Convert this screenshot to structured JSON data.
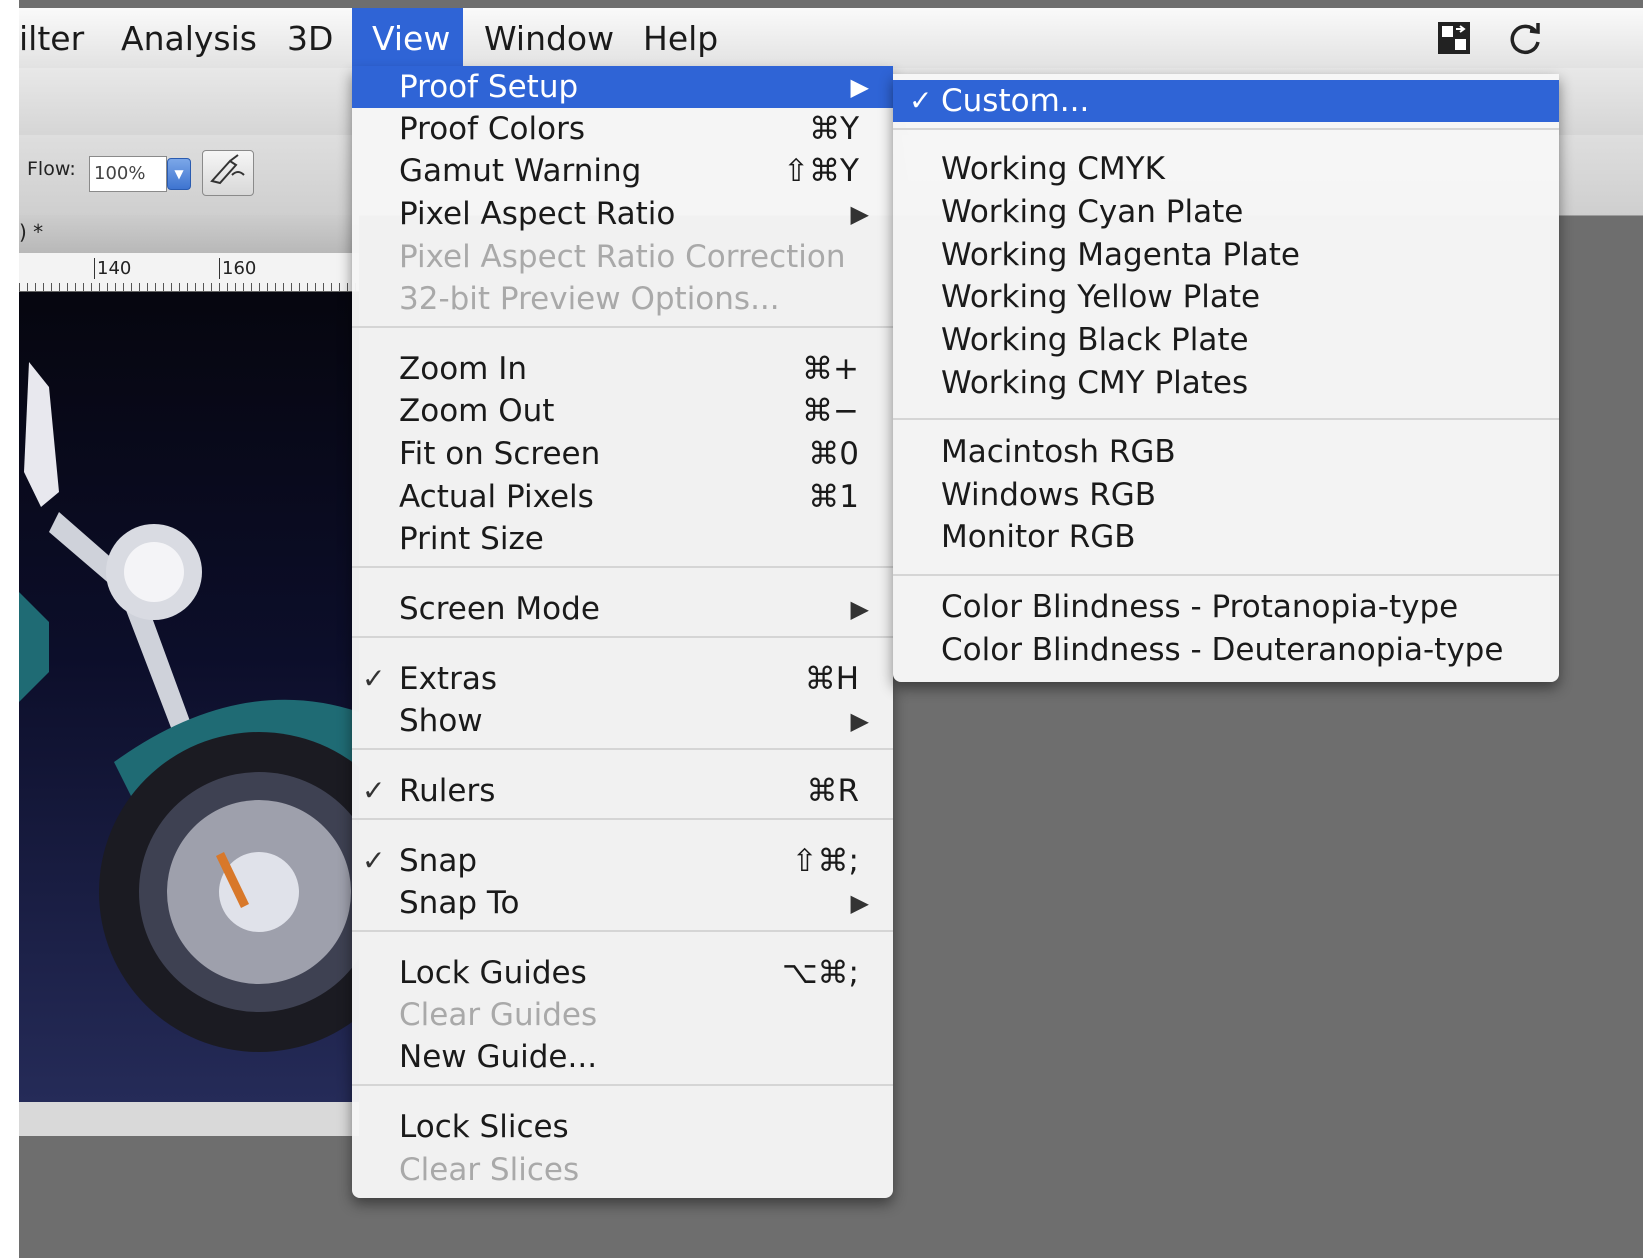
{
  "menubar": {
    "items": [
      {
        "label": "ilter"
      },
      {
        "label": "Analysis"
      },
      {
        "label": "3D"
      },
      {
        "label": "View"
      },
      {
        "label": "Window"
      },
      {
        "label": "Help"
      }
    ]
  },
  "options": {
    "flow_label": "Flow:",
    "flow_value": "100%"
  },
  "document": {
    "tab_title": ") *",
    "ruler_labels": [
      "140",
      "160"
    ]
  },
  "view_menu": {
    "items": [
      {
        "label": "Proof Setup",
        "shortcut": "",
        "submenu": true,
        "check": "",
        "state": "highlight"
      },
      {
        "label": "Proof Colors",
        "shortcut": "⌘Y",
        "submenu": false,
        "check": "",
        "state": "normal"
      },
      {
        "label": "Gamut Warning",
        "shortcut": "⇧⌘Y",
        "submenu": false,
        "check": "",
        "state": "normal"
      },
      {
        "label": "Pixel Aspect Ratio",
        "shortcut": "",
        "submenu": true,
        "check": "",
        "state": "normal"
      },
      {
        "label": "Pixel Aspect Ratio Correction",
        "shortcut": "",
        "submenu": false,
        "check": "",
        "state": "disabled"
      },
      {
        "label": "32-bit Preview Options...",
        "shortcut": "",
        "submenu": false,
        "check": "",
        "state": "disabled"
      },
      {
        "label": "Zoom In",
        "shortcut": "⌘+",
        "submenu": false,
        "check": "",
        "state": "normal"
      },
      {
        "label": "Zoom Out",
        "shortcut": "⌘−",
        "submenu": false,
        "check": "",
        "state": "normal"
      },
      {
        "label": "Fit on Screen",
        "shortcut": "⌘0",
        "submenu": false,
        "check": "",
        "state": "normal"
      },
      {
        "label": "Actual Pixels",
        "shortcut": "⌘1",
        "submenu": false,
        "check": "",
        "state": "normal"
      },
      {
        "label": "Print Size",
        "shortcut": "",
        "submenu": false,
        "check": "",
        "state": "normal"
      },
      {
        "label": "Screen Mode",
        "shortcut": "",
        "submenu": true,
        "check": "",
        "state": "normal"
      },
      {
        "label": "Extras",
        "shortcut": "⌘H",
        "submenu": false,
        "check": "✓",
        "state": "normal"
      },
      {
        "label": "Show",
        "shortcut": "",
        "submenu": true,
        "check": "",
        "state": "normal"
      },
      {
        "label": "Rulers",
        "shortcut": "⌘R",
        "submenu": false,
        "check": "✓",
        "state": "normal"
      },
      {
        "label": "Snap",
        "shortcut": "⇧⌘;",
        "submenu": false,
        "check": "✓",
        "state": "normal"
      },
      {
        "label": "Snap To",
        "shortcut": "",
        "submenu": true,
        "check": "",
        "state": "normal"
      },
      {
        "label": "Lock Guides",
        "shortcut": "⌥⌘;",
        "submenu": false,
        "check": "",
        "state": "normal"
      },
      {
        "label": "Clear Guides",
        "shortcut": "",
        "submenu": false,
        "check": "",
        "state": "disabled"
      },
      {
        "label": "New Guide...",
        "shortcut": "",
        "submenu": false,
        "check": "",
        "state": "normal"
      },
      {
        "label": "Lock Slices",
        "shortcut": "",
        "submenu": false,
        "check": "",
        "state": "normal"
      },
      {
        "label": "Clear Slices",
        "shortcut": "",
        "submenu": false,
        "check": "",
        "state": "disabled"
      }
    ]
  },
  "proof_setup_submenu": {
    "items": [
      {
        "label": "Custom...",
        "check": "✓",
        "state": "highlight"
      },
      {
        "label": "Working CMYK",
        "check": "",
        "state": "normal"
      },
      {
        "label": "Working Cyan Plate",
        "check": "",
        "state": "normal"
      },
      {
        "label": "Working Magenta Plate",
        "check": "",
        "state": "normal"
      },
      {
        "label": "Working Yellow Plate",
        "check": "",
        "state": "normal"
      },
      {
        "label": "Working Black Plate",
        "check": "",
        "state": "normal"
      },
      {
        "label": "Working CMY Plates",
        "check": "",
        "state": "normal"
      },
      {
        "label": "Macintosh RGB",
        "check": "",
        "state": "normal"
      },
      {
        "label": "Windows RGB",
        "check": "",
        "state": "normal"
      },
      {
        "label": "Monitor RGB",
        "check": "",
        "state": "normal"
      },
      {
        "label": "Color Blindness - Protanopia-type",
        "check": "",
        "state": "normal"
      },
      {
        "label": "Color Blindness - Deuteranopia-type",
        "check": "",
        "state": "normal"
      }
    ]
  },
  "icons": {
    "menubar_right": [
      "screen-arrange-icon",
      "sync-icon"
    ],
    "airbrush": "airbrush-icon",
    "submenu_arrow": "submenu-arrow-icon"
  },
  "colors": {
    "highlight": "#2f64d6",
    "disabled_text": "#a9a9a9"
  }
}
